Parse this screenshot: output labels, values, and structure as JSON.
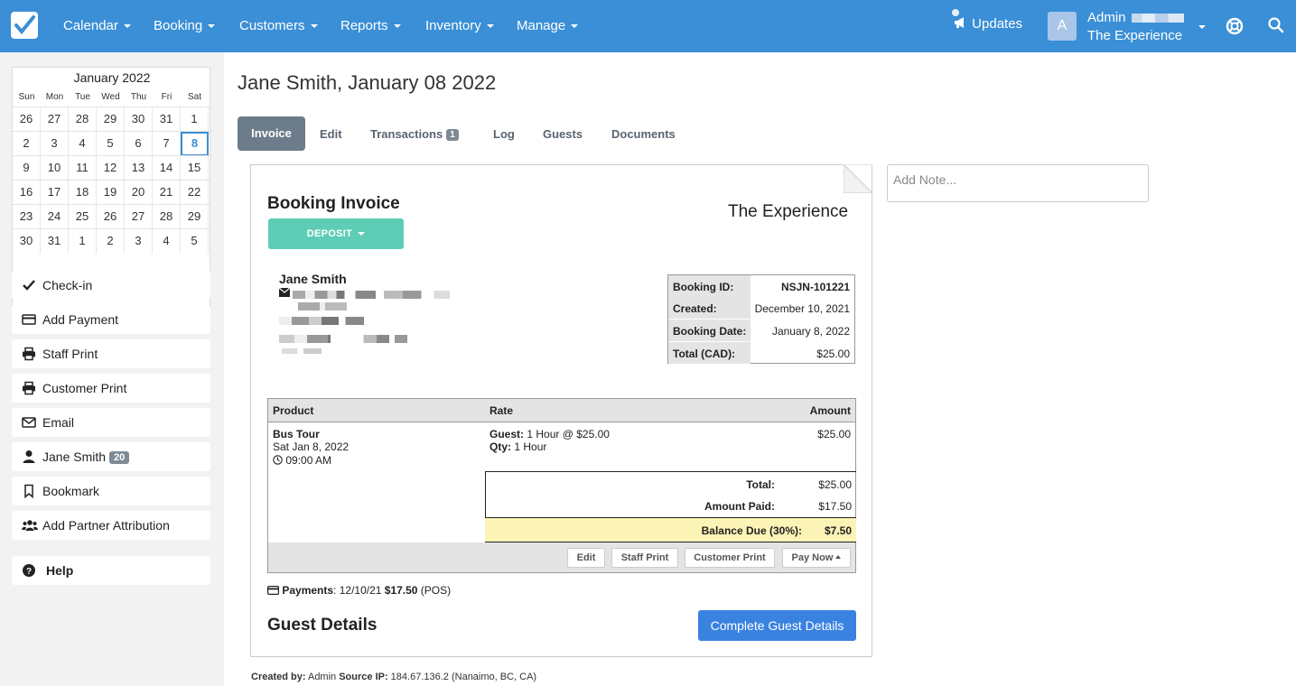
{
  "nav": {
    "items": [
      "Calendar",
      "Booking",
      "Customers",
      "Reports",
      "Inventory",
      "Manage"
    ],
    "updates": "Updates",
    "avatar_initial": "A",
    "admin_name": "Admin",
    "admin_org": "The Experience",
    "icons": [
      "logo-check-icon",
      "megaphone-icon",
      "lifesaver-icon",
      "search-icon"
    ]
  },
  "calendar": {
    "title": "January 2022",
    "weekdays": [
      "Sun",
      "Mon",
      "Tue",
      "Wed",
      "Thu",
      "Fri",
      "Sat"
    ],
    "weeks": [
      [
        "26",
        "27",
        "28",
        "29",
        "30",
        "31",
        "1"
      ],
      [
        "2",
        "3",
        "4",
        "5",
        "6",
        "7",
        "8"
      ],
      [
        "9",
        "10",
        "11",
        "12",
        "13",
        "14",
        "15"
      ],
      [
        "16",
        "17",
        "18",
        "19",
        "20",
        "21",
        "22"
      ],
      [
        "23",
        "24",
        "25",
        "26",
        "27",
        "28",
        "29"
      ],
      [
        "30",
        "31",
        "1",
        "2",
        "3",
        "4",
        "5"
      ]
    ],
    "selected": "8"
  },
  "sidebar": {
    "actions": [
      {
        "label": "Check-in",
        "icon": "check-icon"
      },
      {
        "label": "Add Payment",
        "icon": "credit-card-icon"
      },
      {
        "label": "Staff Print",
        "icon": "printer-icon"
      },
      {
        "label": "Customer Print",
        "icon": "printer-icon"
      },
      {
        "label": "Email",
        "icon": "envelope-icon"
      },
      {
        "label": "Jane Smith",
        "icon": "user-icon",
        "badge": "20"
      },
      {
        "label": "Bookmark",
        "icon": "bookmark-icon"
      },
      {
        "label": "Add Partner Attribution",
        "icon": "users-icon"
      }
    ],
    "help": "Help"
  },
  "page": {
    "title": "Jane Smith, January 08 2022",
    "tabs": [
      {
        "label": "Invoice",
        "active": true
      },
      {
        "label": "Edit"
      },
      {
        "label": "Transactions",
        "badge": "1"
      },
      {
        "label": "Log"
      },
      {
        "label": "Guests"
      },
      {
        "label": "Documents"
      }
    ],
    "note_placeholder": "Add Note..."
  },
  "invoice": {
    "title": "Booking Invoice",
    "org": "The Experience",
    "status_button": "DEPOSIT",
    "customer_name": "Jane Smith",
    "info": [
      {
        "key": "Booking ID:",
        "value": "NSJN-101221",
        "bold": true
      },
      {
        "key": "Created:",
        "value": "December 10, 2021"
      },
      {
        "key": "Booking Date:",
        "value": "January 8, 2022"
      },
      {
        "key": "Total (CAD):",
        "value": "$25.00"
      }
    ],
    "columns": {
      "product": "Product",
      "rate": "Rate",
      "amount": "Amount"
    },
    "line": {
      "product": "Bus Tour",
      "date": "Sat Jan 8, 2022",
      "time": "09:00 AM",
      "guest_label": "Guest:",
      "guest_value": "1 Hour @ $25.00",
      "qty_label": "Qty:",
      "qty_value": "1 Hour",
      "amount": "$25.00"
    },
    "totals": {
      "total_label": "Total:",
      "total_value": "$25.00",
      "paid_label": "Amount Paid:",
      "paid_value": "$17.50",
      "due_label": "Balance Due (30%):",
      "due_value": "$7.50"
    },
    "footer_buttons": [
      "Edit",
      "Staff Print",
      "Customer Print",
      "Pay Now"
    ],
    "payments_label": "Payments",
    "payments_date": ": 12/10/21 ",
    "payments_amount": "$17.50",
    "payments_method": " (POS)",
    "guest_details_title": "Guest Details",
    "guest_details_button": "Complete Guest Details"
  },
  "footer": {
    "created_by_label": "Created by:",
    "created_by_value": " Admin ",
    "source_ip_label": "Source IP:",
    "source_ip_value": " 184.67.136.2 (Nanaimo, BC, CA)"
  }
}
